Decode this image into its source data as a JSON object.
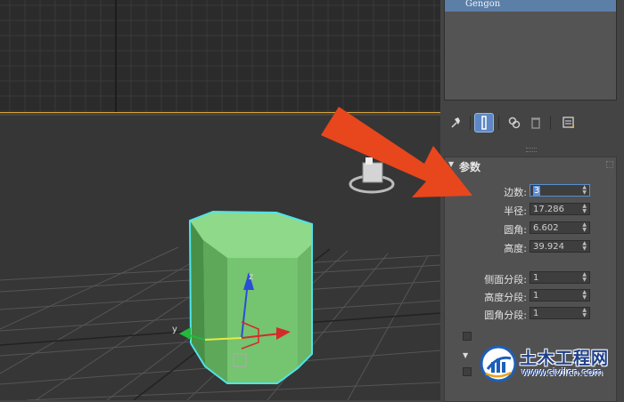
{
  "object_list": {
    "selected_item": "Gengon"
  },
  "toolbar": {
    "buttons": [
      {
        "icon": "pin-stack-icon",
        "glyph": "📌"
      },
      {
        "icon": "show-end-result-icon",
        "glyph": "┃"
      },
      {
        "icon": "make-unique-icon",
        "glyph": "⦿"
      },
      {
        "icon": "remove-modifier-icon",
        "glyph": "🗑"
      },
      {
        "icon": "configure-modifier-sets-icon",
        "glyph": "▦"
      }
    ]
  },
  "rollout": {
    "title": "参数",
    "params": [
      {
        "label": "边数:",
        "value": "3",
        "focused": true
      },
      {
        "label": "半径:",
        "value": "17.286"
      },
      {
        "label": "圆角:",
        "value": "6.602"
      },
      {
        "label": "高度:",
        "value": "39.924"
      },
      {
        "label": "侧面分段:",
        "value": "1"
      },
      {
        "label": "高度分段:",
        "value": "1"
      },
      {
        "label": "圆角分段:",
        "value": "1"
      }
    ]
  },
  "gizmo": {
    "x_label": "y",
    "z_label": "z"
  },
  "watermark": {
    "name": "土木工程网",
    "url": "www.civilcn.com"
  },
  "colors": {
    "annotation_arrow": "#e8461d",
    "object_fill": "#7fc87a",
    "selection_outline": "#4fe4ea",
    "list_selection": "#5b7fa7"
  }
}
